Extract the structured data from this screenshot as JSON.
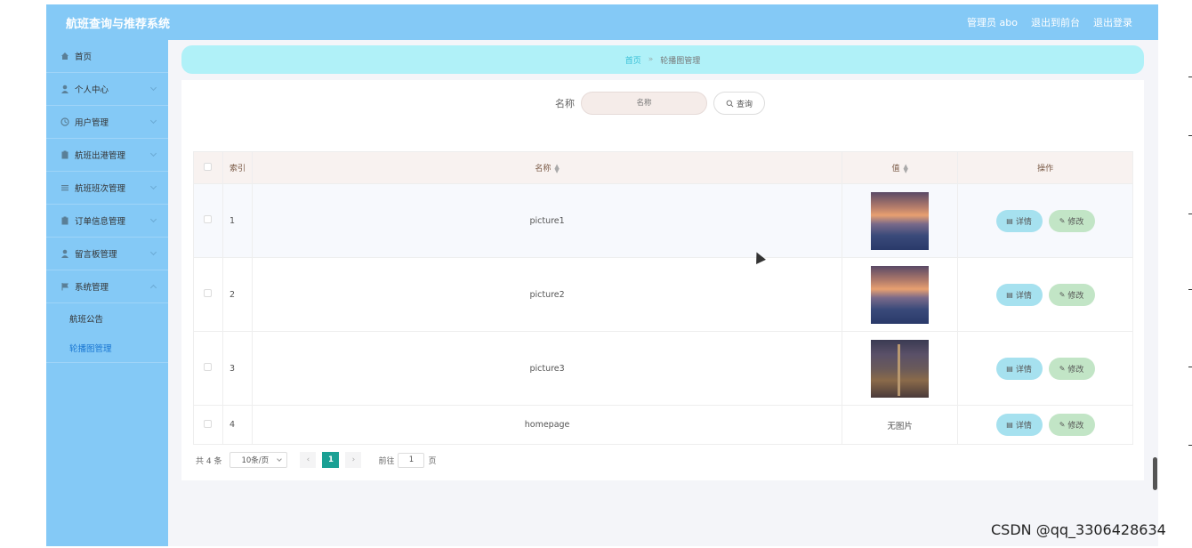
{
  "header": {
    "title": "航班查询与推荐系统",
    "user": "管理员 abo",
    "to_front": "退出到前台",
    "logout": "退出登录"
  },
  "sidebar": {
    "items": [
      {
        "label": "首页",
        "icon": "home-icon"
      },
      {
        "label": "个人中心",
        "icon": "user-icon"
      },
      {
        "label": "用户管理",
        "icon": "clock-icon"
      },
      {
        "label": "航班出港管理",
        "icon": "clipboard-icon"
      },
      {
        "label": "航班班次管理",
        "icon": "list-icon"
      },
      {
        "label": "订单信息管理",
        "icon": "clipboard-icon"
      },
      {
        "label": "留言板管理",
        "icon": "user-icon"
      },
      {
        "label": "系统管理",
        "icon": "flag-icon"
      }
    ],
    "sub_items": [
      {
        "label": "航班公告"
      },
      {
        "label": "轮播图管理"
      }
    ]
  },
  "breadcrumb": {
    "home": "首页",
    "separator": "»",
    "current": "轮播图管理"
  },
  "search": {
    "label": "名称",
    "placeholder": "名称",
    "button": "查询"
  },
  "table": {
    "headers": {
      "index": "索引",
      "name": "名称",
      "value": "值",
      "actions": "操作"
    },
    "rows": [
      {
        "index": "1",
        "name": "picture1",
        "value_image": "sunset-thumbnail"
      },
      {
        "index": "2",
        "name": "picture2",
        "value_image": "sunset-thumbnail"
      },
      {
        "index": "3",
        "name": "picture3",
        "value_image": "city-thumbnail"
      },
      {
        "index": "4",
        "name": "homepage",
        "value_text": "无图片"
      }
    ],
    "detail_label": "详情",
    "edit_label": "修改"
  },
  "pagination": {
    "total": "共 4 条",
    "page_size": "10条/页",
    "current_page": "1",
    "goto_label": "前往",
    "goto_value": "1",
    "page_suffix": "页"
  },
  "watermark": "CSDN @qq_3306428634",
  "colors": {
    "topbar": "#84c9f6",
    "breadcrumb": "#b0f1f8",
    "detail_button": "#a6e1ef",
    "edit_button": "#c2e5c6",
    "pager_active": "#1aa094"
  }
}
